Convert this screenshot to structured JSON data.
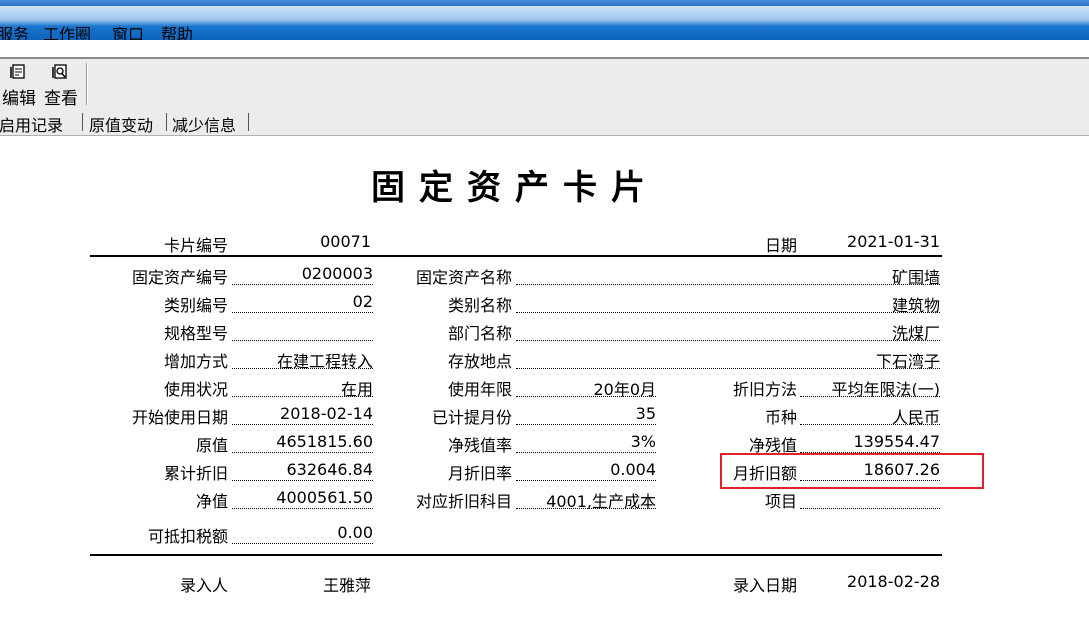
{
  "menubar": {
    "items": [
      {
        "label": "服务"
      },
      {
        "label": "工作圈"
      },
      {
        "label": "窗口"
      },
      {
        "label": "帮助"
      }
    ]
  },
  "toolbar": {
    "edit_label": "编辑",
    "view_label": "查看",
    "edit_icon": "edit-doc-icon",
    "view_icon": "view-doc-icon"
  },
  "tabs": [
    {
      "label": "停启用记录"
    },
    {
      "label": "原值变动"
    },
    {
      "label": "减少信息"
    }
  ],
  "card": {
    "title": "固定资产卡片",
    "card_no_label": "卡片编号",
    "card_no": "00071",
    "date_label": "日期",
    "date": "2021-01-31",
    "asset_code_label": "固定资产编号",
    "asset_code": "0200003",
    "asset_name_label": "固定资产名称",
    "asset_name": "矿围墙",
    "category_code_label": "类别编号",
    "category_code": "02",
    "category_name_label": "类别名称",
    "category_name": "建筑物",
    "spec_label": "规格型号",
    "spec": "",
    "dept_label": "部门名称",
    "dept": "洗煤厂",
    "add_method_label": "增加方式",
    "add_method": "在建工程转入",
    "location_label": "存放地点",
    "location": "下石湾子",
    "status_label": "使用状况",
    "status": "在用",
    "life_label": "使用年限",
    "life": "20年0月",
    "dep_method_label": "折旧方法",
    "dep_method": "平均年限法(一)",
    "start_date_label": "开始使用日期",
    "start_date": "2018-02-14",
    "months_label": "已计提月份",
    "months": "35",
    "currency_label": "币种",
    "currency": "人民币",
    "orig_value_label": "原值",
    "orig_value": "4651815.60",
    "residual_rate_label": "净残值率",
    "residual_rate": "3%",
    "residual_label": "净残值",
    "residual": "139554.47",
    "acc_dep_label": "累计折旧",
    "acc_dep": "632646.84",
    "monthly_rate_label": "月折旧率",
    "monthly_rate": "0.004",
    "monthly_amount_label": "月折旧额",
    "monthly_amount": "18607.26",
    "net_value_label": "净值",
    "net_value": "4000561.50",
    "dep_account_label": "对应折旧科目",
    "dep_account": "4001,生产成本",
    "project_label": "项目",
    "project": "",
    "tax_label": "可抵扣税额",
    "tax": "0.00",
    "entered_by_label": "录入人",
    "entered_by": "王雅萍",
    "entry_date_label": "录入日期",
    "entry_date": "2018-02-28"
  },
  "highlight_color": "#e0242b"
}
